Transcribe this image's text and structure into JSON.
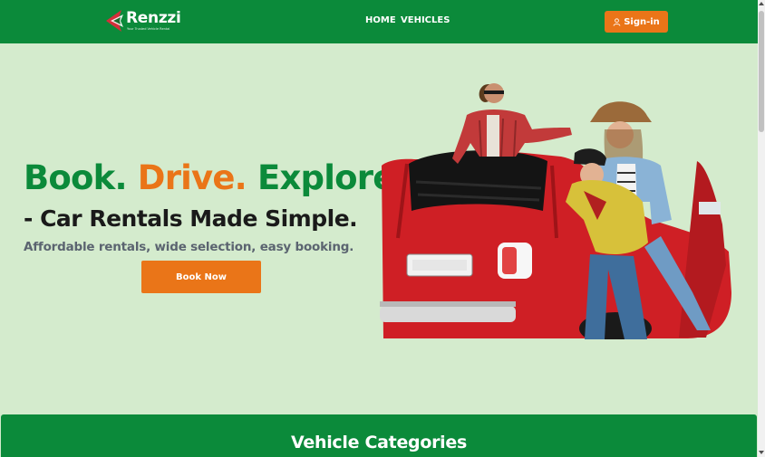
{
  "brand": {
    "name": "Renzzi",
    "tagline": "Your Trusted Vehicle Rental"
  },
  "nav": {
    "home": "HOME",
    "vehicles": "VEHICLES",
    "signin": "Sign-in"
  },
  "hero": {
    "title_part1": "Book.",
    "title_part2": "Drive.",
    "title_part3": "Explore",
    "subtitle": "- Car Rentals Made Simple.",
    "tagline": "Affordable rentals, wide selection, easy booking.",
    "cta": "Book Now"
  },
  "categories": {
    "title": "Vehicle Categories"
  },
  "icons": {
    "signin_icon": "user-icon",
    "logo_icon": "renzzi-logo-mark"
  },
  "colors": {
    "primary_green": "#0b8a3a",
    "accent_orange": "#ea7518",
    "hero_bg": "#d4ebcd"
  }
}
